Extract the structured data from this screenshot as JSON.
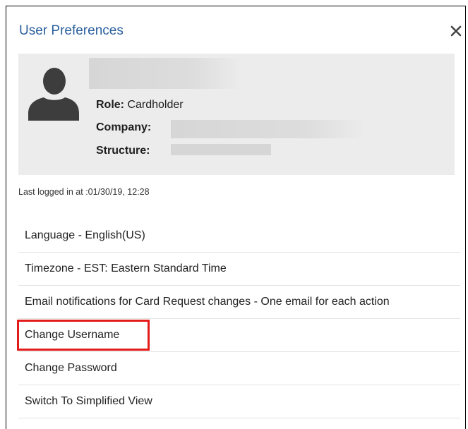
{
  "dialog": {
    "title": "User Preferences",
    "close_icon": "close-icon"
  },
  "profile": {
    "avatar_icon": "user-silhouette-icon",
    "role_label": "Role:",
    "role_value": "Cardholder",
    "company_label": "Company:",
    "structure_label": "Structure:"
  },
  "last_login": "Last logged in at :01/30/19, 12:28",
  "menu": {
    "items": [
      {
        "label": "Language - English(US)"
      },
      {
        "label": "Timezone - EST: Eastern Standard Time"
      },
      {
        "label": "Email notifications for Card Request changes - One email for each action"
      },
      {
        "label": "Change Username"
      },
      {
        "label": "Change Password"
      },
      {
        "label": "Switch To Simplified View"
      }
    ]
  },
  "colors": {
    "title": "#2a5f9e",
    "panel_bg": "#ececec",
    "highlight": "#e41b1b"
  }
}
